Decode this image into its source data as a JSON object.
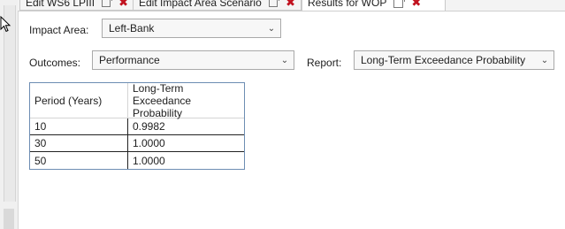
{
  "tabs": [
    {
      "label": "Edit WS6 LPIII",
      "active": false
    },
    {
      "label": "Edit Impact Area Scenario",
      "active": false
    },
    {
      "label": "Results for WOP",
      "active": true
    }
  ],
  "form": {
    "impact_area_label": "Impact Area:",
    "impact_area_value": "Left-Bank",
    "outcomes_label": "Outcomes:",
    "outcomes_value": "Performance",
    "report_label": "Report:",
    "report_value": "Long-Term Exceedance Probability"
  },
  "table": {
    "headers": [
      "Period (Years)",
      "Long-Term Exceedance Probability"
    ],
    "rows": [
      [
        "10",
        "0.9982"
      ],
      [
        "30",
        "1.0000"
      ],
      [
        "50",
        "1.0000"
      ]
    ]
  },
  "colors": {
    "close_icon": "#c1121f",
    "grid_border": "#6d8db3"
  }
}
